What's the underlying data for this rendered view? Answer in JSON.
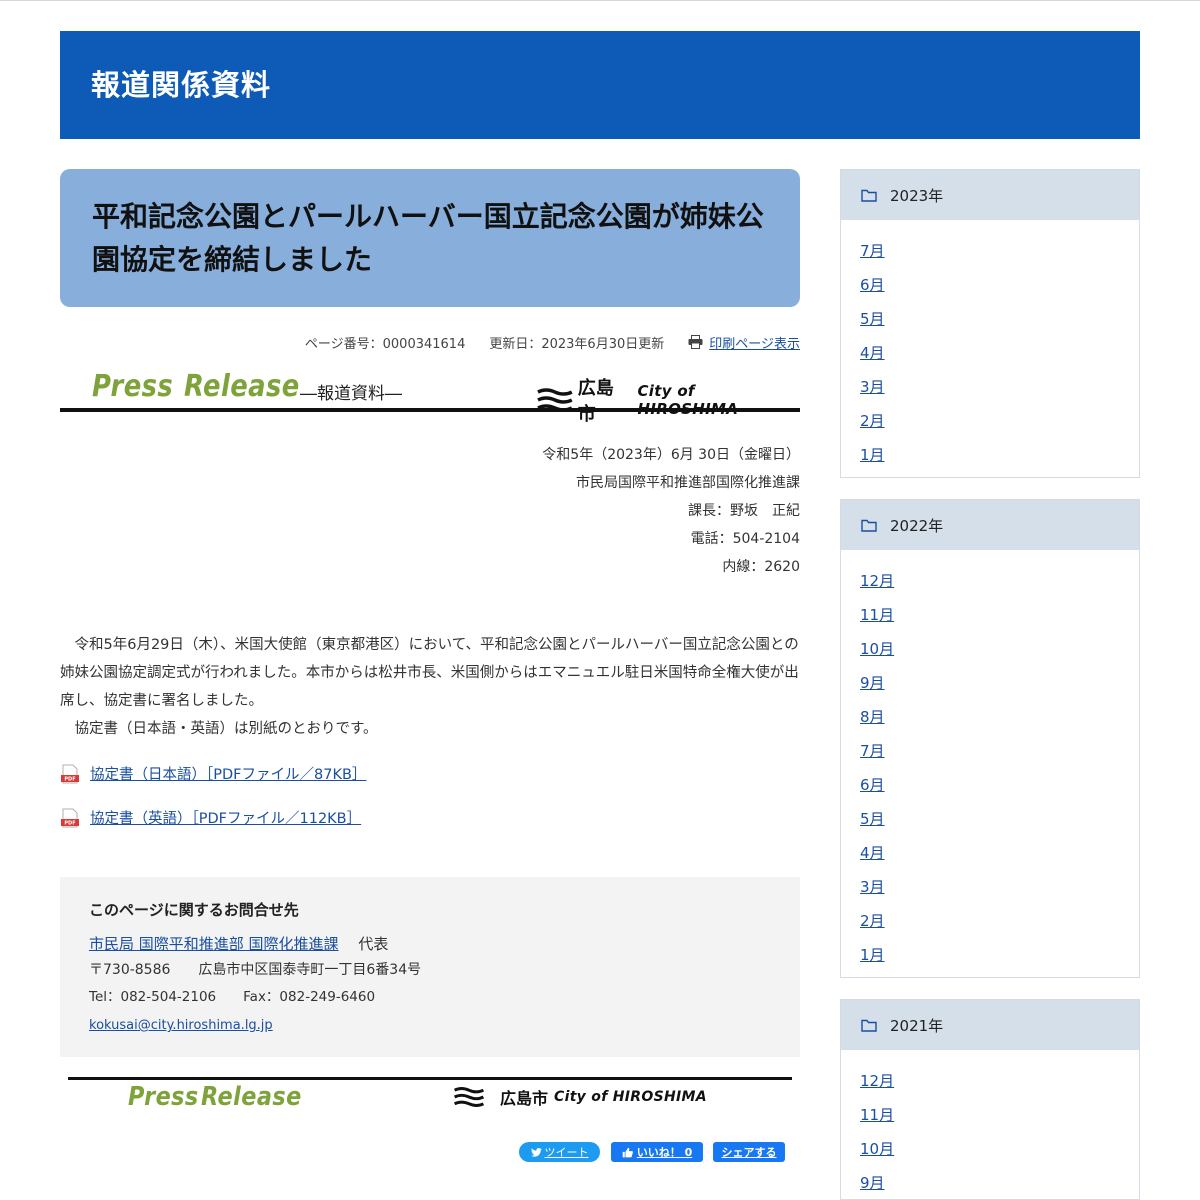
{
  "header": {
    "title": "報道関係資料"
  },
  "article": {
    "title": "平和記念公園とパールハーバー国立記念公園が姉妹公園協定を締結しました",
    "meta": {
      "page_number": "ページ番号：0000341614",
      "updated": "更新日：2023年6月30日更新",
      "print_link": "印刷ページ表示"
    },
    "press_banner": {
      "press_word_1": "Press",
      "press_word_2": "Release",
      "subtitle": "―報道資料―",
      "city_jp": "広島市",
      "city_en": "City of HIROSHIMA"
    },
    "sender": {
      "date": "令和5年（2023年）6月 30日（金曜日）",
      "department": "市民局国際平和推進部国際化推進課",
      "chief": "課長：野坂　正紀",
      "phone": "電話：504-2104",
      "extension": "内線：2620"
    },
    "body": {
      "paragraph_1": "　令和5年6月29日（木）、米国大使館（東京都港区）において、平和記念公園とパールハーバー国立記念公園との姉妹公園協定調定式が行われました。本市からは松井市長、米国側からはエマニュエル駐日米国特命全権大使が出席し、協定書に署名しました。",
      "paragraph_2": "　協定書（日本語・英語）は別紙のとおりです。"
    },
    "attachments": [
      {
        "label": "協定書（日本語）［PDFファイル／87KB］",
        "icon": "pdf-icon"
      },
      {
        "label": "協定書（英語）［PDFファイル／112KB］",
        "icon": "pdf-icon"
      }
    ],
    "contact": {
      "heading": "このページに関するお問合せ先",
      "dept_link": "市民局 国際平和推進部 国際化推進課",
      "dept_suffix": "代表",
      "address": "〒730-8586　　広島市中区国泰寺町一丁目6番34号",
      "tel_fax": "Tel：082-504-2106　　Fax：082-249-6460",
      "email": "kokusai@city.hiroshima.lg.jp"
    },
    "footer_banner": {
      "press_word_1": "Press",
      "press_word_2": "Release",
      "city_jp": "広島市",
      "city_en": "City of HIROSHIMA"
    },
    "share": {
      "tweet": "ツイート",
      "like": "いいね！ 0",
      "share": "シェアする"
    }
  },
  "sidebar": {
    "years": [
      {
        "year": "2023年",
        "months": [
          "7月",
          "6月",
          "5月",
          "4月",
          "3月",
          "2月",
          "1月"
        ]
      },
      {
        "year": "2022年",
        "months": [
          "12月",
          "11月",
          "10月",
          "9月",
          "8月",
          "7月",
          "6月",
          "5月",
          "4月",
          "3月",
          "2月",
          "1月"
        ]
      },
      {
        "year": "2021年",
        "months": [
          "12月",
          "11月",
          "10月",
          "9月"
        ]
      }
    ]
  },
  "colors": {
    "header_bg": "#0e5ab7",
    "title_bg": "#88aedb",
    "link": "#1a4fa0",
    "press_green": "#7ea33a",
    "sidebar_head_bg": "#d4dfea"
  }
}
